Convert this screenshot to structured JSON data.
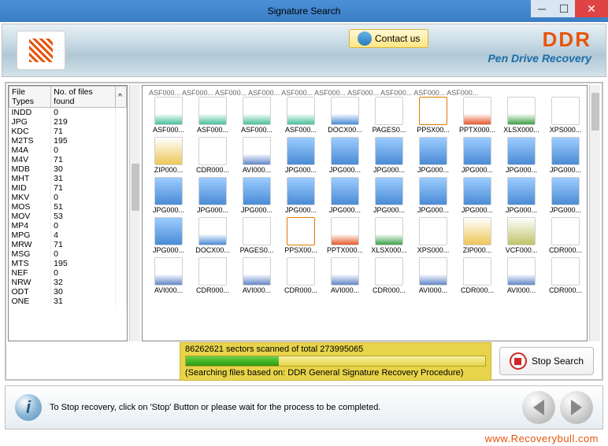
{
  "window": {
    "title": "Signature Search"
  },
  "header": {
    "contact_label": "Contact us",
    "brand": "DDR",
    "subtitle": "Pen Drive Recovery"
  },
  "table": {
    "col1": "File Types",
    "col2": "No. of files found",
    "rows": [
      {
        "t": "INDD",
        "n": "0"
      },
      {
        "t": "JPG",
        "n": "219"
      },
      {
        "t": "KDC",
        "n": "71"
      },
      {
        "t": "M2TS",
        "n": "195"
      },
      {
        "t": "M4A",
        "n": "0"
      },
      {
        "t": "M4V",
        "n": "71"
      },
      {
        "t": "MDB",
        "n": "30"
      },
      {
        "t": "MHT",
        "n": "31"
      },
      {
        "t": "MID",
        "n": "71"
      },
      {
        "t": "MKV",
        "n": "0"
      },
      {
        "t": "MOS",
        "n": "51"
      },
      {
        "t": "MOV",
        "n": "53"
      },
      {
        "t": "MP4",
        "n": "0"
      },
      {
        "t": "MPG",
        "n": "4"
      },
      {
        "t": "MRW",
        "n": "71"
      },
      {
        "t": "MSG",
        "n": "0"
      },
      {
        "t": "MTS",
        "n": "195"
      },
      {
        "t": "NEF",
        "n": "0"
      },
      {
        "t": "NRW",
        "n": "32"
      },
      {
        "t": "ODT",
        "n": "30"
      },
      {
        "t": "ONE",
        "n": "31"
      }
    ]
  },
  "grid": {
    "trunc_row": "ASF000...  ASF000...  ASF000...  ASF000...  ASF000...  ASF000...  ASF000...  ASF000...  ASF000...  ASF000...",
    "rows": [
      [
        {
          "l": "ASF000...",
          "c": "asf"
        },
        {
          "l": "ASF000...",
          "c": "asf"
        },
        {
          "l": "ASF000...",
          "c": "asf"
        },
        {
          "l": "ASF000...",
          "c": "asf"
        },
        {
          "l": "DOCX00...",
          "c": "doc"
        },
        {
          "l": "PAGES0...",
          "c": "page"
        },
        {
          "l": "PPSX00...",
          "c": "pps"
        },
        {
          "l": "PPTX000...",
          "c": "ppt"
        },
        {
          "l": "XLSX000...",
          "c": "xls"
        },
        {
          "l": "XPS000...",
          "c": "xps"
        }
      ],
      [
        {
          "l": "ZIP000...",
          "c": "zip"
        },
        {
          "l": "CDR000...",
          "c": "page"
        },
        {
          "l": "AVI000...",
          "c": "avi"
        },
        {
          "l": "JPG000...",
          "c": "jpg"
        },
        {
          "l": "JPG000...",
          "c": "jpg"
        },
        {
          "l": "JPG000...",
          "c": "jpg"
        },
        {
          "l": "JPG000...",
          "c": "jpg"
        },
        {
          "l": "JPG000...",
          "c": "jpg"
        },
        {
          "l": "JPG000...",
          "c": "jpg"
        },
        {
          "l": "JPG000...",
          "c": "jpg"
        }
      ],
      [
        {
          "l": "JPG000...",
          "c": "jpg"
        },
        {
          "l": "JPG000...",
          "c": "jpg"
        },
        {
          "l": "JPG000...",
          "c": "jpg"
        },
        {
          "l": "JPG000...",
          "c": "jpg"
        },
        {
          "l": "JPG000...",
          "c": "jpg"
        },
        {
          "l": "JPG000...",
          "c": "jpg"
        },
        {
          "l": "JPG000...",
          "c": "jpg"
        },
        {
          "l": "JPG000...",
          "c": "jpg"
        },
        {
          "l": "JPG000...",
          "c": "jpg"
        },
        {
          "l": "JPG000...",
          "c": "jpg"
        }
      ],
      [
        {
          "l": "JPG000...",
          "c": "jpg"
        },
        {
          "l": "DOCX00...",
          "c": "doc"
        },
        {
          "l": "PAGES0...",
          "c": "page"
        },
        {
          "l": "PPSX00...",
          "c": "pps"
        },
        {
          "l": "PPTX000...",
          "c": "ppt"
        },
        {
          "l": "XLSX000...",
          "c": "xls"
        },
        {
          "l": "XPS000...",
          "c": "xps"
        },
        {
          "l": "ZIP000...",
          "c": "zip"
        },
        {
          "l": "VCF000...",
          "c": "vcf"
        },
        {
          "l": "CDR000...",
          "c": "page"
        }
      ],
      [
        {
          "l": "AVI000...",
          "c": "avi"
        },
        {
          "l": "CDR000...",
          "c": "page"
        },
        {
          "l": "AVI000...",
          "c": "avi"
        },
        {
          "l": "CDR000...",
          "c": "page"
        },
        {
          "l": "AVI000...",
          "c": "avi"
        },
        {
          "l": "CDR000...",
          "c": "page"
        },
        {
          "l": "AVI000...",
          "c": "avi"
        },
        {
          "l": "CDR000...",
          "c": "page"
        },
        {
          "l": "AVI000...",
          "c": "avi"
        },
        {
          "l": "CDR000...",
          "c": "page"
        }
      ]
    ]
  },
  "progress": {
    "status": "86262621 sectors scanned of total 273995065",
    "note": "(Searching files based on:  DDR General Signature Recovery Procedure)"
  },
  "stop_label": "Stop Search",
  "footer": {
    "tip": "To Stop recovery, click on 'Stop' Button or please wait for the process to be completed."
  },
  "watermark": "www.Recoverybull.com"
}
